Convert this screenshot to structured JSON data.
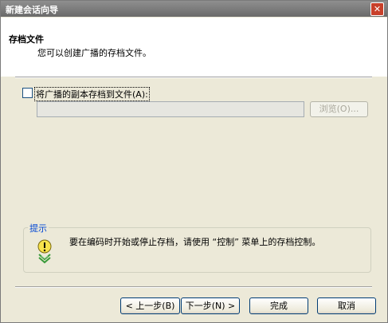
{
  "window": {
    "title": "新建会话向导",
    "close_glyph": "✕"
  },
  "header": {
    "title": "存档文件",
    "subtitle": "您可以创建广播的存档文件。"
  },
  "archive": {
    "checkbox_label": "将广播的副本存档到文件(A):",
    "checked": false,
    "file_path": "",
    "browse_label": "浏览(O)..."
  },
  "tip": {
    "caption": "提示",
    "text": "要在编码时开始或停止存档，请使用 “控制” 菜单上的存档控制。",
    "icon": "lightbulb-icon"
  },
  "buttons": {
    "back": "< 上一步(B)",
    "next": "下一步(N) >",
    "finish": "完成",
    "cancel": "取消"
  }
}
